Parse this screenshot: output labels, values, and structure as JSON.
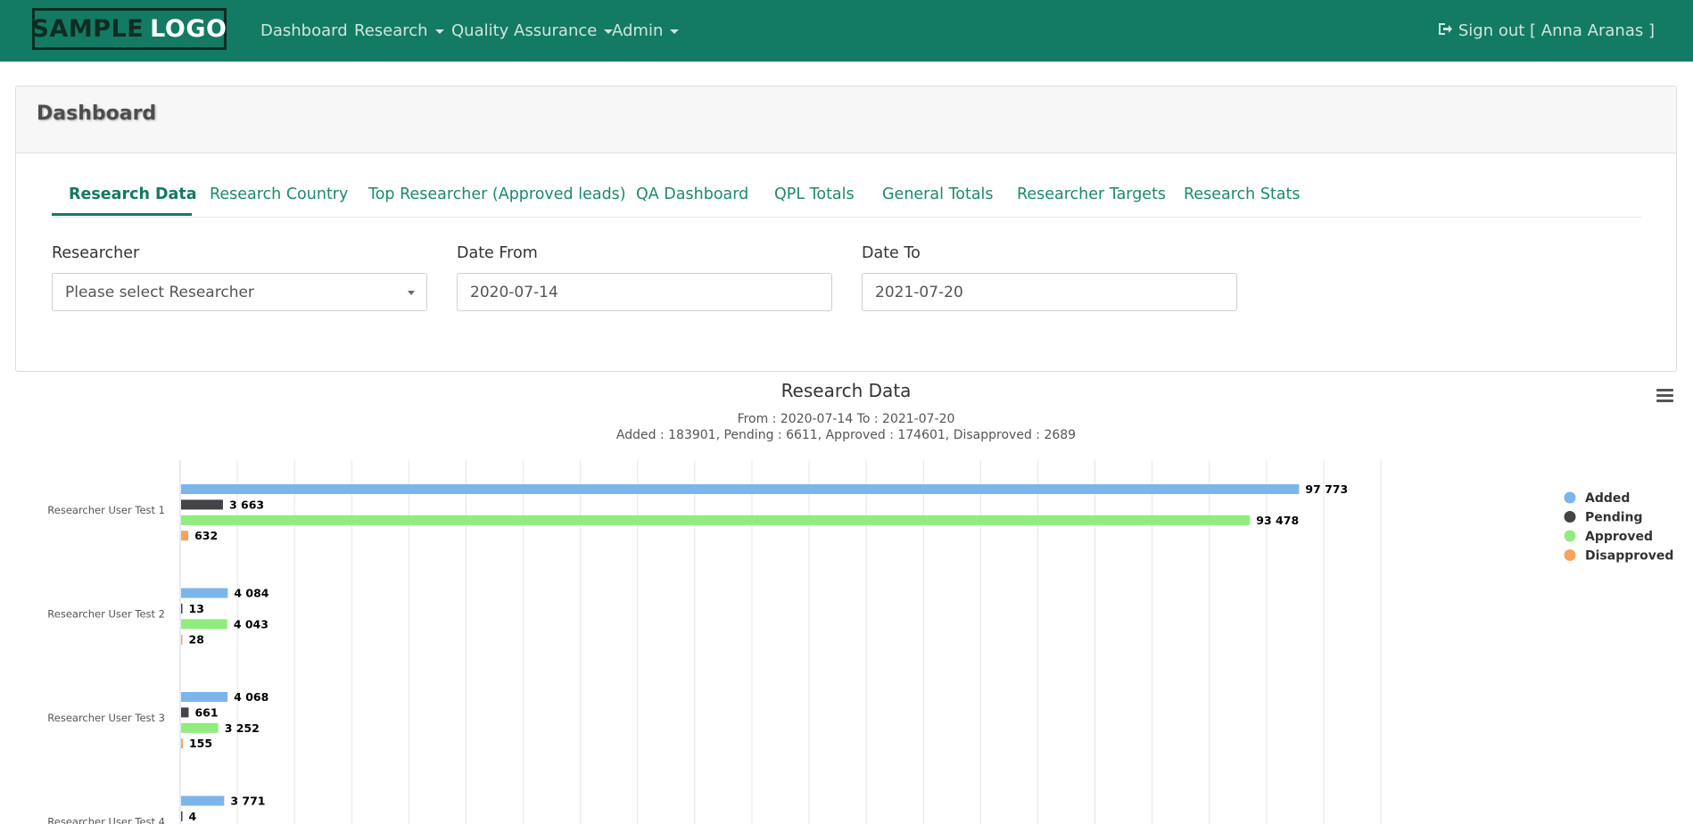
{
  "navbar": {
    "logo_part1": "SAMPLE",
    "logo_part2": "LOGO",
    "items": [
      {
        "label": "Dashboard",
        "dropdown": false
      },
      {
        "label": "Research",
        "dropdown": true
      },
      {
        "label": "Quality Assurance",
        "dropdown": true
      },
      {
        "label": "Admin",
        "dropdown": true
      }
    ],
    "signout_label": "Sign out [ Anna Aranas ]",
    "background_color": "#137a63"
  },
  "card": {
    "title": "Dashboard",
    "tabs": [
      {
        "label": "Research Data",
        "active": true
      },
      {
        "label": "Research Country",
        "active": false
      },
      {
        "label": "Top Researcher (Approved leads)",
        "active": false
      },
      {
        "label": "QA Dashboard",
        "active": false
      },
      {
        "label": "QPL Totals",
        "active": false
      },
      {
        "label": "General Totals",
        "active": false
      },
      {
        "label": "Researcher Targets",
        "active": false
      },
      {
        "label": "Research Stats",
        "active": false
      }
    ],
    "filters": {
      "researcher": {
        "label": "Researcher",
        "placeholder": "Please select Researcher"
      },
      "date_from": {
        "label": "Date From",
        "value": "2020-07-14"
      },
      "date_to": {
        "label": "Date To",
        "value": "2021-07-20"
      }
    }
  },
  "chart_data": {
    "type": "bar",
    "orientation": "horizontal",
    "title": "Research Data",
    "subtitle_line1": "From : 2020-07-14 To : 2021-07-20",
    "subtitle_line2": "Added : 183901, Pending : 6611, Approved : 174601, Disapproved : 2689",
    "categories": [
      "Researcher User Test 1",
      "Researcher User Test 2",
      "Researcher User Test 3",
      "Researcher User Test 4"
    ],
    "series": [
      {
        "name": "Added",
        "color": "#7cb5ec",
        "values": [
          97773,
          4084,
          4068,
          3771
        ]
      },
      {
        "name": "Pending",
        "color": "#434348",
        "values": [
          3663,
          13,
          661,
          4
        ]
      },
      {
        "name": "Approved",
        "color": "#90ed7d",
        "values": [
          93478,
          4043,
          3252,
          null
        ]
      },
      {
        "name": "Disapproved",
        "color": "#f7a35c",
        "values": [
          632,
          28,
          155,
          null
        ]
      }
    ],
    "xlim": [
      0,
      105000
    ],
    "grid": true,
    "legend": "right"
  }
}
